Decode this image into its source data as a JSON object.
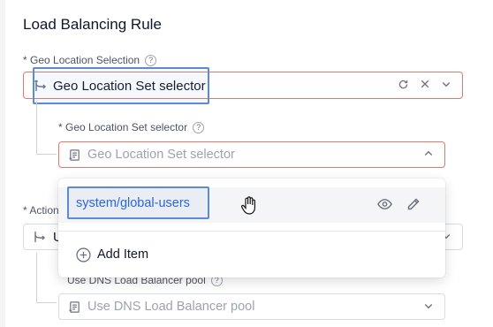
{
  "title": "Load Balancing Rule",
  "geo_selection": {
    "label": "* Geo Location Selection",
    "value": "Geo Location Set selector"
  },
  "geo_set_selector": {
    "label": "* Geo Location Set selector",
    "placeholder": "Geo Location Set selector"
  },
  "dropdown": {
    "options": [
      {
        "label": "system/global-users"
      }
    ],
    "add_item_label": "Add Item"
  },
  "action": {
    "label": "* Action",
    "value_prefix": "U"
  },
  "dns_pool": {
    "label": "Use DNS Load Balancer pool",
    "placeholder": "Use DNS Load Balancer pool"
  },
  "colors": {
    "error_border": "#e07a6e",
    "focus_outline": "#5b8bd4",
    "link_blue": "#2563eb"
  },
  "icons": [
    "branch-icon",
    "refresh-icon",
    "clear-icon",
    "chevron-down-icon",
    "chevron-up-icon",
    "help-circle-icon",
    "list-icon",
    "eye-icon",
    "pencil-icon",
    "plus-circle-icon",
    "hand-cursor-icon"
  ]
}
